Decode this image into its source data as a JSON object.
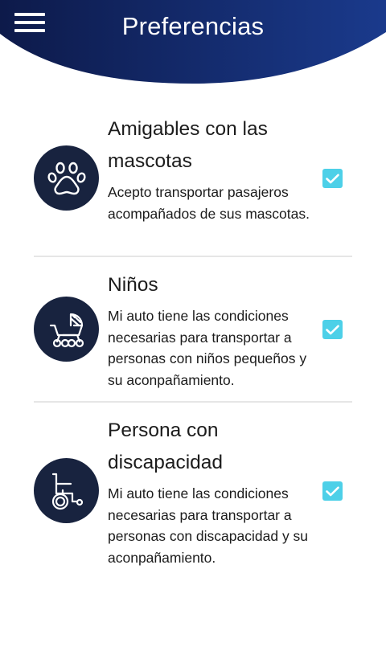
{
  "header": {
    "title": "Preferencias",
    "menu_icon": "hamburger-menu-icon",
    "gradient_colors": [
      "#0d1a4a",
      "#1a3a8c"
    ]
  },
  "preferences": [
    {
      "title": "Amigables con las mascotas",
      "description": "Acepto transportar pasajeros acompañados de sus mascotas.",
      "icon": "paw-icon",
      "checked": true
    },
    {
      "title": "Niños",
      "description": "Mi auto tiene las condiciones necesarias para transportar a personas con niños pequeños y su aconpañamiento.",
      "icon": "baby-stroller-icon",
      "checked": true
    },
    {
      "title": "Persona con discapacidad",
      "description": "Mi auto tiene las condiciones necesarias para transportar a personas con discapacidad y su aconpañamiento.",
      "icon": "wheelchair-icon",
      "checked": true
    }
  ],
  "colors": {
    "accent_checkbox": "#4dd0e8",
    "icon_background": "#18233f",
    "divider": "#e6e6e6"
  }
}
